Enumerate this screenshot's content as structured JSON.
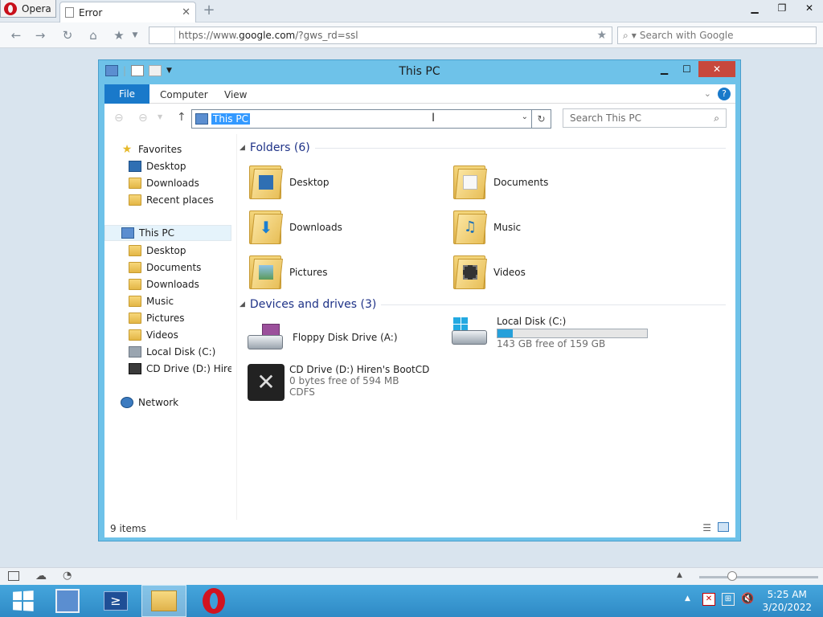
{
  "browser": {
    "menu_label": "Opera",
    "tab_title": "Error",
    "url_prefix": "https://www.",
    "url_domain": "google.com",
    "url_path": "/?gws_rd=ssl",
    "search_placeholder": "Search with Google"
  },
  "explorer": {
    "title": "This PC",
    "ribbon_tabs": [
      "File",
      "Computer",
      "View"
    ],
    "address": "This PC",
    "search_placeholder": "Search This PC",
    "nav": {
      "favorites": "Favorites",
      "fav_items": [
        "Desktop",
        "Downloads",
        "Recent places"
      ],
      "this_pc": "This PC",
      "pc_items": [
        "Desktop",
        "Documents",
        "Downloads",
        "Music",
        "Pictures",
        "Videos",
        "Local Disk (C:)",
        "CD Drive (D:) Hiren's BootCD"
      ],
      "network": "Network"
    },
    "folders_header": "Folders (6)",
    "folders": [
      "Desktop",
      "Documents",
      "Downloads",
      "Music",
      "Pictures",
      "Videos"
    ],
    "devices_header": "Devices and drives (3)",
    "devices": {
      "floppy": "Floppy Disk Drive (A:)",
      "local_disk": "Local Disk (C:)",
      "local_disk_free": "143 GB free of 159 GB",
      "local_disk_used_fraction": 0.1,
      "cd_drive": "CD Drive (D:) Hiren's BootCD",
      "cd_free": "0 bytes free of 594 MB",
      "cd_fs": "CDFS"
    },
    "status": "9 items"
  },
  "taskbar": {
    "time": "5:25 AM",
    "date": "3/20/2022"
  }
}
